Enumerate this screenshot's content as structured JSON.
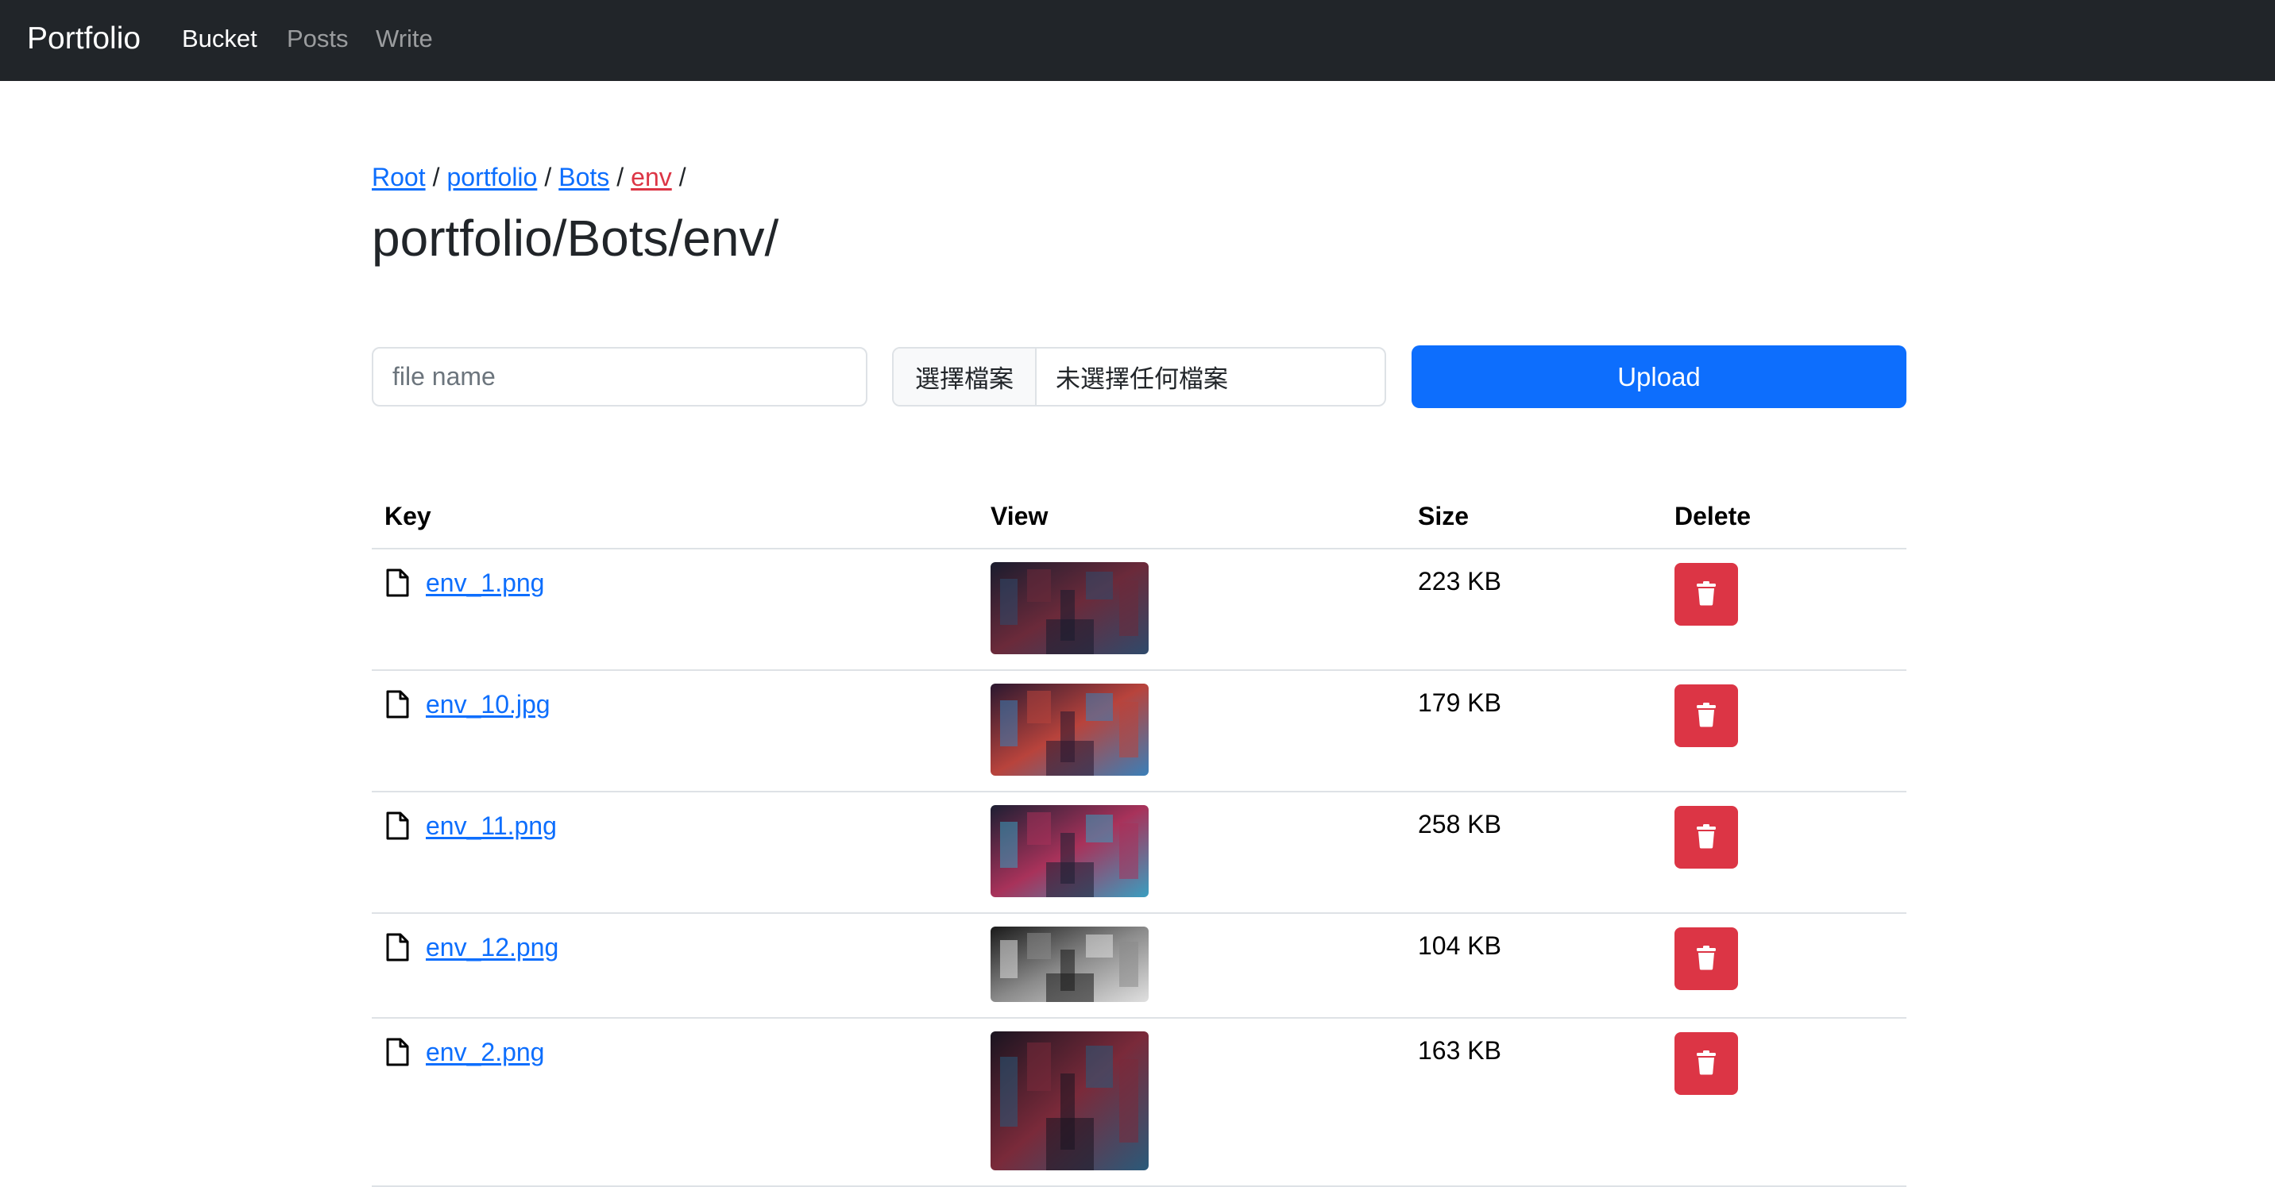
{
  "navbar": {
    "brand": "Portfolio",
    "links": [
      {
        "label": "Bucket",
        "active": true
      },
      {
        "label": "Posts",
        "active": false
      },
      {
        "label": "Write",
        "active": false
      }
    ]
  },
  "breadcrumb": [
    {
      "label": "Root"
    },
    {
      "label": "portfolio"
    },
    {
      "label": "Bots"
    },
    {
      "label": "env",
      "current": true
    }
  ],
  "breadcrumb_separator": "/",
  "page_title": "portfolio/Bots/env/",
  "upload_form": {
    "filename_placeholder": "file name",
    "choose_file_label": "選擇檔案",
    "no_file_label": "未選擇任何檔案",
    "upload_label": "Upload"
  },
  "table": {
    "headers": {
      "key": "Key",
      "view": "View",
      "size": "Size",
      "delete": "Delete"
    },
    "rows": [
      {
        "key": "env_1.png",
        "size": "223 KB",
        "thumb_colors": [
          "#1a1c2e",
          "#6b2a3a",
          "#2f4a6b"
        ]
      },
      {
        "key": "env_10.jpg",
        "size": "179 KB",
        "thumb_colors": [
          "#2a1830",
          "#b8433c",
          "#3a7fb8"
        ]
      },
      {
        "key": "env_11.png",
        "size": "258 KB",
        "thumb_colors": [
          "#1d1f33",
          "#a8325a",
          "#3a9ec0"
        ]
      },
      {
        "key": "env_12.png",
        "size": "104 KB",
        "thumb_colors": [
          "#1a1a1a",
          "#8a8a8a",
          "#e0e0e0"
        ]
      },
      {
        "key": "env_2.png",
        "size": "163 KB",
        "thumb_colors": [
          "#1a1420",
          "#7a2a3a",
          "#2a5a7a"
        ]
      }
    ]
  },
  "colors": {
    "navbar_bg": "#212529",
    "link": "#0d6efd",
    "breadcrumb_current": "#dc3545",
    "primary": "#0d6efd",
    "danger": "#dc3545",
    "border": "#dee2e6"
  }
}
